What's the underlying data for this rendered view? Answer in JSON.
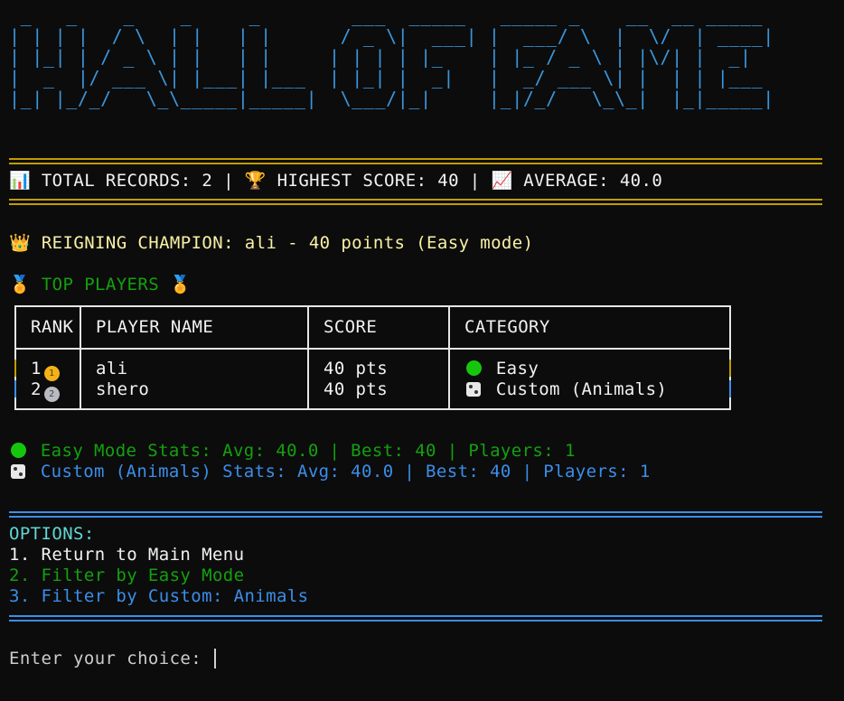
{
  "banner": {
    "ascii_art": " _   _    _    _     _        ___  _____   _____ _    __  __ _____ \n| | | |  / \\  | |   | |      / _ \\|  ___| |  ___/ \\  |  \\/  | ____|\n| |_| | / _ \\ | |   | |     | | | | |_    | |_ / _ \\ | |\\/| |  _|  \n|  _  |/ ___ \\| |___| |___  | |_| |  _|   |  _/ ___ \\| |  | | |___ \n|_| |_/_/   \\_\\_____|_____|  \\___/|_|     |_|/_/   \\_\\_|  |_|_____|",
    "text": "HALL OF FAME"
  },
  "summary": {
    "records_icon": "bar-chart-icon",
    "records_label": "TOTAL RECORDS: 2",
    "sep1": " | ",
    "score_icon": "trophy-icon",
    "highest_label": "HIGHEST SCORE: 40",
    "sep2": " | ",
    "avg_icon": "trend-up-icon",
    "average_label": "AVERAGE: 40.0"
  },
  "champion": {
    "icon": "crown-icon",
    "text": "REIGNING CHAMPION: ali - 40 points (Easy mode)"
  },
  "top_players": {
    "icon": "medal-icon",
    "title": "TOP PLAYERS"
  },
  "table": {
    "headers": [
      "RANK",
      "PLAYER NAME",
      "SCORE",
      "CATEGORY"
    ],
    "rows": [
      {
        "rank": "1",
        "medal": "gold-medal-icon",
        "player": "ali",
        "score": "40 pts",
        "category_icon": "green-circle-icon",
        "category": "Easy",
        "color": "#c19c00"
      },
      {
        "rank": "2",
        "medal": "silver-medal-icon",
        "player": "shero",
        "score": "40 pts",
        "category_icon": "die-icon",
        "category": "Custom (Animals)",
        "color": "#3b8eea"
      }
    ]
  },
  "stats": {
    "easy": "Easy Mode Stats: Avg: 40.0 | Best: 40 | Players: 1",
    "custom": "Custom (Animals) Stats: Avg: 40.0 | Best: 40 | Players: 1"
  },
  "options": {
    "title": "OPTIONS:",
    "items": [
      "1. Return to Main Menu",
      "2. Filter by Easy Mode",
      "3. Filter by Custom: Animals"
    ]
  },
  "prompt": {
    "text": "Enter your choice: "
  },
  "colors": {
    "background": "#0c0c0c",
    "gold": "#c19c00",
    "blue": "#3b8eea",
    "green": "#13a10e",
    "cyan": "#61d6d6"
  }
}
